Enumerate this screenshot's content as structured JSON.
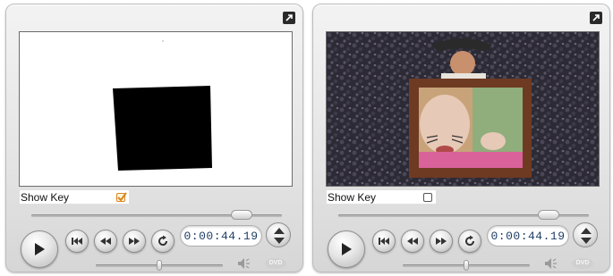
{
  "players": [
    {
      "show_key_label": "Show Key",
      "show_key_checked": true,
      "timecode": "0:00:44.19",
      "scrubber_fraction": 0.84,
      "volume_fraction": 0.5,
      "dvd_label": "DVD",
      "icons": {
        "expand": "expand-icon",
        "play": "play-icon",
        "go_to_start": "skip-to-start-icon",
        "rewind": "rewind-icon",
        "fast_forward": "fast-forward-icon",
        "loop": "loop-icon",
        "jog": "up-down-arrows-icon",
        "speaker": "speaker-icon"
      }
    },
    {
      "show_key_label": "Show Key",
      "show_key_checked": false,
      "timecode": "0:00:44.19",
      "scrubber_fraction": 0.84,
      "volume_fraction": 0.5,
      "dvd_label": "DVD",
      "icons": {
        "expand": "expand-icon",
        "play": "play-icon",
        "go_to_start": "skip-to-start-icon",
        "rewind": "rewind-icon",
        "fast_forward": "fast-forward-icon",
        "loop": "loop-icon",
        "jog": "up-down-arrows-icon",
        "speaker": "speaker-icon"
      }
    }
  ],
  "colors": {
    "timecode_text": "#1f3e66",
    "checkbox_checked": "#d8861c",
    "key_mask": "#000000"
  }
}
